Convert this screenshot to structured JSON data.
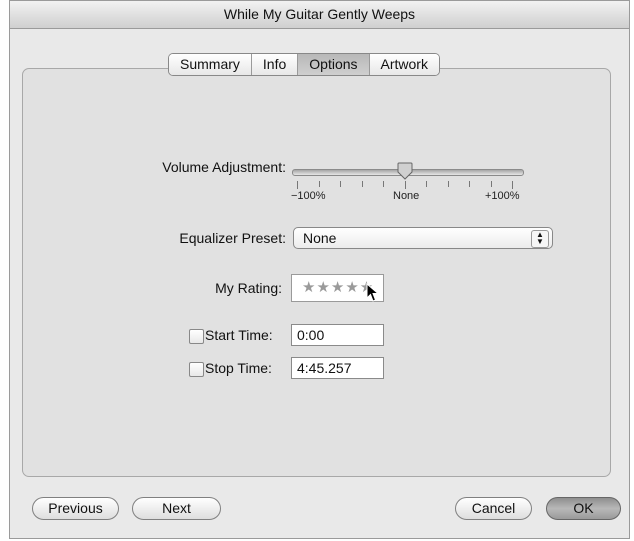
{
  "window": {
    "title": "While My Guitar Gently Weeps"
  },
  "tabs": [
    {
      "label": "Summary",
      "active": false
    },
    {
      "label": "Info",
      "active": false
    },
    {
      "label": "Options",
      "active": true
    },
    {
      "label": "Artwork",
      "active": false
    }
  ],
  "options": {
    "volume": {
      "label": "Volume Adjustment:",
      "min_label": "−100%",
      "mid_label": "None",
      "max_label": "+100%",
      "value_fraction": 0.5
    },
    "equalizer": {
      "label": "Equalizer Preset:",
      "selected": "None"
    },
    "rating": {
      "label": "My Rating:",
      "stars": "★★★★★"
    },
    "start_time": {
      "label": "Start Time:",
      "value": "0:00",
      "checked": false
    },
    "stop_time": {
      "label": "Stop Time:",
      "value": "4:45.257",
      "checked": false
    }
  },
  "buttons": {
    "previous": "Previous",
    "next": "Next",
    "cancel": "Cancel",
    "ok": "OK"
  }
}
